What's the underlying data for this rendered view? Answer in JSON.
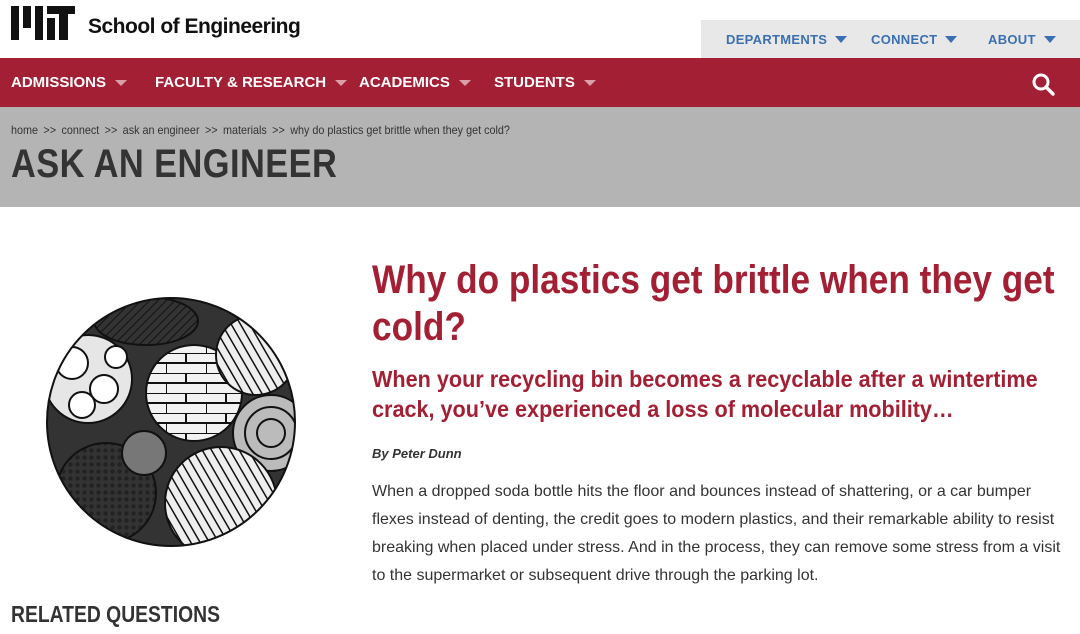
{
  "header": {
    "logo_alt": "MIT",
    "site_name": "School of Engineering",
    "util_nav": [
      {
        "label": "DEPARTMENTS"
      },
      {
        "label": "CONNECT"
      },
      {
        "label": "ABOUT"
      }
    ]
  },
  "main_nav": [
    {
      "label": "ADMISSIONS"
    },
    {
      "label": "FACULTY & RESEARCH"
    },
    {
      "label": "ACADEMICS"
    },
    {
      "label": "STUDENTS"
    }
  ],
  "breadcrumb": {
    "items": [
      "home",
      "connect",
      "ask an engineer",
      "materials",
      "why do plastics get brittle when they get cold?"
    ],
    "separator": ">>"
  },
  "page_title": "ASK AN ENGINEER",
  "article": {
    "title": "Why do plastics get brittle when they get cold?",
    "subtitle": "When your recycling bin becomes a recyclable after a wintertime crack, you’ve experienced a loss of molecular mobility…",
    "byline": "By Peter Dunn",
    "body": "When a dropped soda bottle hits the floor and bounces instead of shattering, or a car bumper flexes instead of denting, the credit goes to modern plastics, and their remarkable ability to resist breaking when placed under stress. And in the process, they can remove some stress from a visit to the supermarket or subsequent drive through the parking lot."
  },
  "sidebar": {
    "related_heading": "RELATED QUESTIONS"
  },
  "colors": {
    "brand_red": "#a31f34",
    "util_blue": "#3b6fb0",
    "header_grey": "#b4b4b4"
  },
  "icons": [
    "mit-logo",
    "chevron-down-icon",
    "search-icon"
  ]
}
